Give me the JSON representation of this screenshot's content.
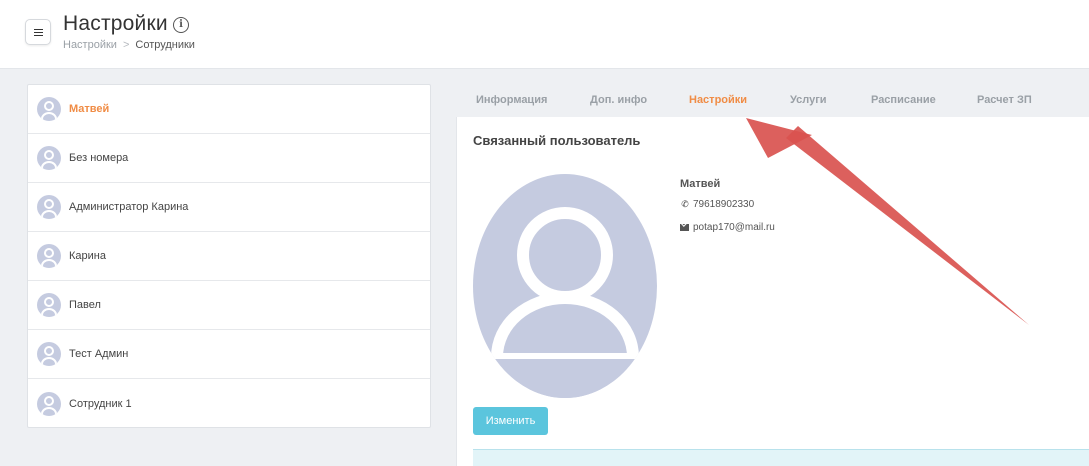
{
  "header": {
    "title": "Настройки",
    "breadcrumb": {
      "root": "Настройки",
      "sep": ">",
      "current": "Сотрудники"
    }
  },
  "employees": [
    {
      "name": "Матвей",
      "active": true
    },
    {
      "name": "Без номера",
      "active": false
    },
    {
      "name": "Администратор Карина",
      "active": false
    },
    {
      "name": "Карина",
      "active": false
    },
    {
      "name": "Павел",
      "active": false
    },
    {
      "name": "Тест Админ",
      "active": false
    },
    {
      "name": "Сотрудник 1",
      "active": false
    }
  ],
  "tabs": [
    {
      "label": "Информация",
      "active": false
    },
    {
      "label": "Доп. инфо",
      "active": false
    },
    {
      "label": "Настройки",
      "active": true
    },
    {
      "label": "Услуги",
      "active": false
    },
    {
      "label": "Расписание",
      "active": false
    },
    {
      "label": "Расчет ЗП",
      "active": false
    }
  ],
  "panel": {
    "title": "Связанный пользователь",
    "user": {
      "name": "Матвей",
      "phone": "79618902330",
      "email": "potap170@mail.ru"
    },
    "change_label": "Изменить"
  },
  "colors": {
    "accent": "#f08c45",
    "button": "#5bc5dd",
    "avatar": "#c5cbe0",
    "arrow": "#d9534f"
  }
}
